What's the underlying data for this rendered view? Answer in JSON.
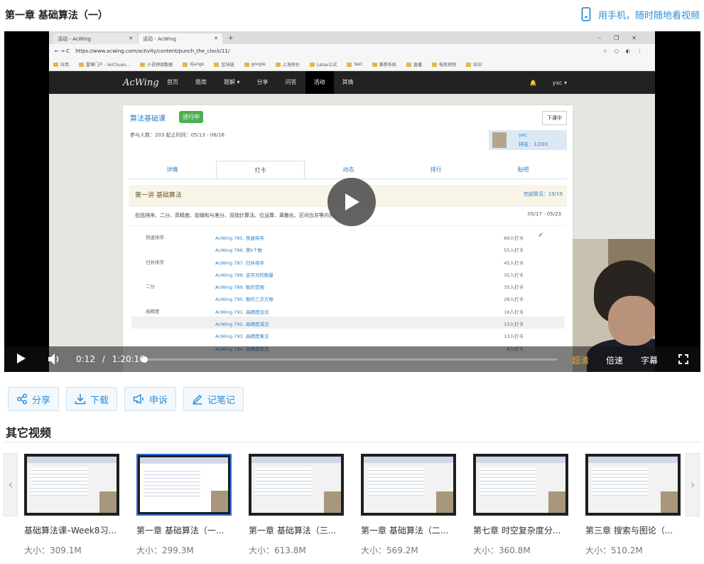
{
  "header": {
    "title": "第一章 基础算法（一）",
    "mobile_link": "用手机，随时随地看视频"
  },
  "screen": {
    "browser_tabs": [
      "活动 - AcWing",
      "活动 - AcWing"
    ],
    "url": "https://www.acwing.com/activity/content/punch_the_clock/11/",
    "bookmarks": [
      "应用",
      "雷锋门户 - leiChuan...",
      "小说预测数据",
      "django",
      "区块链",
      "google",
      "上海房价",
      "Latex公式",
      "test",
      "推荐系统",
      "直播",
      "电商预测",
      "培训"
    ],
    "nav": {
      "logo": "AcWing",
      "items": [
        "首页",
        "题库",
        "题解 ▾",
        "分享",
        "问答",
        "活动",
        "其情"
      ],
      "active_index": 5,
      "user": "yxc ▾"
    },
    "course": {
      "title": "算法基础课",
      "status": "进行中",
      "leave_button": "下课中",
      "meta": "参与人数：203    起止时间：05/13 - 06/16",
      "user_name": "yxc",
      "user_rank": "排名：1/203",
      "tabs": [
        "详情",
        "打卡",
        "动态",
        "排行",
        "贴吧"
      ],
      "active_tab": 1,
      "lecture_title": "第一讲 基础算法",
      "lecture_progress": "完成情况：19/19",
      "lecture_desc": "包括排序、二分、高精度、前缀和与差分、双指针算法、位运算、离散化、区间合并等内容。",
      "lecture_date": "05/17 - 05/23",
      "problems": [
        {
          "category": "快速排序",
          "name": "AcWing 785. 快速排序",
          "count": "69人打卡",
          "done": true
        },
        {
          "category": "",
          "name": "AcWing 786. 第k个数",
          "count": "55人打卡",
          "done": false
        },
        {
          "category": "归并排序",
          "name": "AcWing 787. 归并排序",
          "count": "45人打卡",
          "done": false
        },
        {
          "category": "",
          "name": "AcWing 788. 逆序对的数量",
          "count": "35人打卡",
          "done": false
        },
        {
          "category": "二分",
          "name": "AcWing 789. 数的范围",
          "count": "35人打卡",
          "done": false
        },
        {
          "category": "",
          "name": "AcWing 790. 数的三次方根",
          "count": "28人打卡",
          "done": false
        },
        {
          "category": "高精度",
          "name": "AcWing 791. 高精度加法",
          "count": "16人打卡",
          "done": false
        },
        {
          "category": "",
          "name": "AcWing 792. 高精度减法",
          "count": "13人打卡",
          "done": false
        },
        {
          "category": "",
          "name": "AcWing 793. 高精度乘法",
          "count": "13人打卡",
          "done": false
        },
        {
          "category": "",
          "name": "AcWing 794. 高精度除法",
          "count": "8人打卡",
          "done": false
        }
      ]
    }
  },
  "player": {
    "current_time": "0:12",
    "separator": "/",
    "duration": "1:20:16",
    "progress_fraction": 0.0025,
    "quality": "超清",
    "speed": "倍速",
    "subtitle": "字幕"
  },
  "actions": [
    "分享",
    "下载",
    "申诉",
    "记笔记"
  ],
  "other_videos": {
    "title": "其它视频",
    "items": [
      {
        "name": "基础算法课–Week8习...",
        "size": "大小：309.1M",
        "selected": false
      },
      {
        "name": "第一章 基础算法（一...",
        "size": "大小：299.3M",
        "selected": true
      },
      {
        "name": "第一章 基础算法（三...",
        "size": "大小：613.8M",
        "selected": false
      },
      {
        "name": "第一章 基础算法（二...",
        "size": "大小：569.2M",
        "selected": false
      },
      {
        "name": "第七章 时空复杂度分...",
        "size": "大小：360.8M",
        "selected": false
      },
      {
        "name": "第三章 搜索与图论（...",
        "size": "大小：510.2M",
        "selected": false
      }
    ]
  },
  "colors": {
    "accent": "#2f8fd6",
    "quality": "#f0a03b",
    "status_green": "#4caf50",
    "selected_border": "#2f6fd6"
  },
  "icons": {
    "mobile": "phone-icon",
    "play": "play-icon",
    "volume": "volume-icon",
    "fullscreen": "fullscreen-icon",
    "share": "share-icon",
    "download": "download-icon",
    "complain": "megaphone-icon",
    "note": "pencil-icon"
  }
}
